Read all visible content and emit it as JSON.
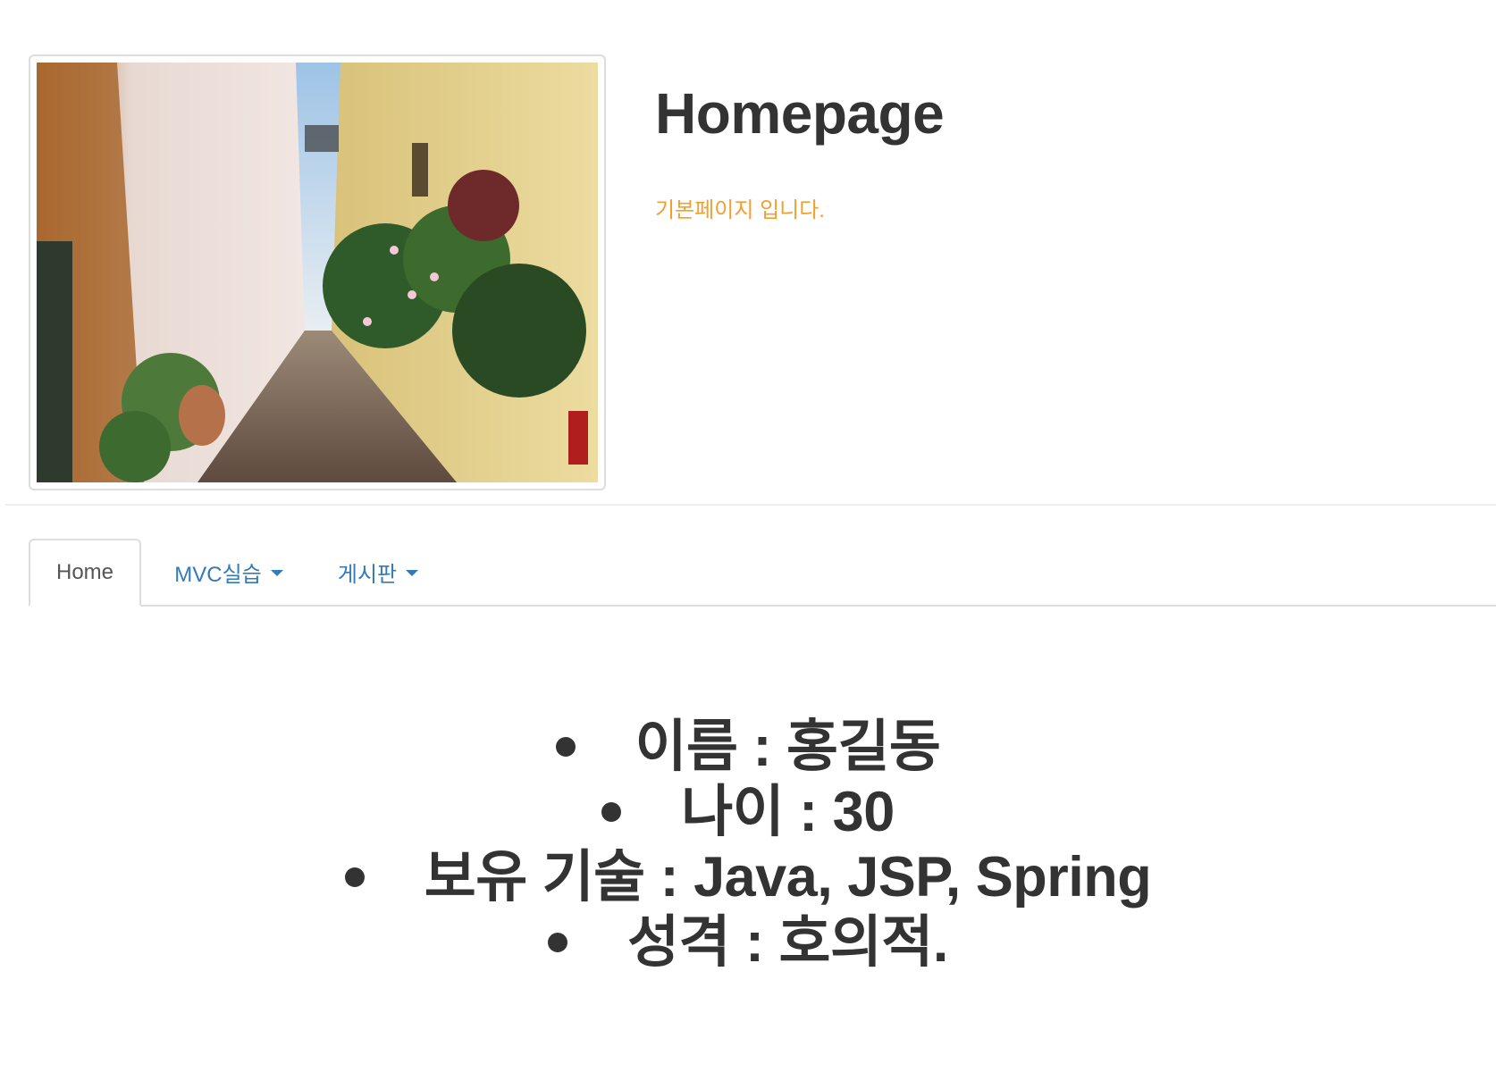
{
  "header": {
    "title": "Homepage",
    "subtitle": "기본페이지 입니다.",
    "image_alt_name": "alley-photo"
  },
  "tabs": [
    {
      "label": "Home",
      "active": true,
      "dropdown": false
    },
    {
      "label": "MVC실습",
      "active": false,
      "dropdown": true
    },
    {
      "label": "게시판",
      "active": false,
      "dropdown": true
    }
  ],
  "profile": {
    "items": [
      "이름 : 홍길동",
      "나이 : 30",
      "보유 기술 : Java, JSP, Spring",
      "성격 : 호의적."
    ]
  },
  "colors": {
    "text": "#333333",
    "subtitle": "#f0a030",
    "link": "#337ab7",
    "border": "#dddddd"
  }
}
